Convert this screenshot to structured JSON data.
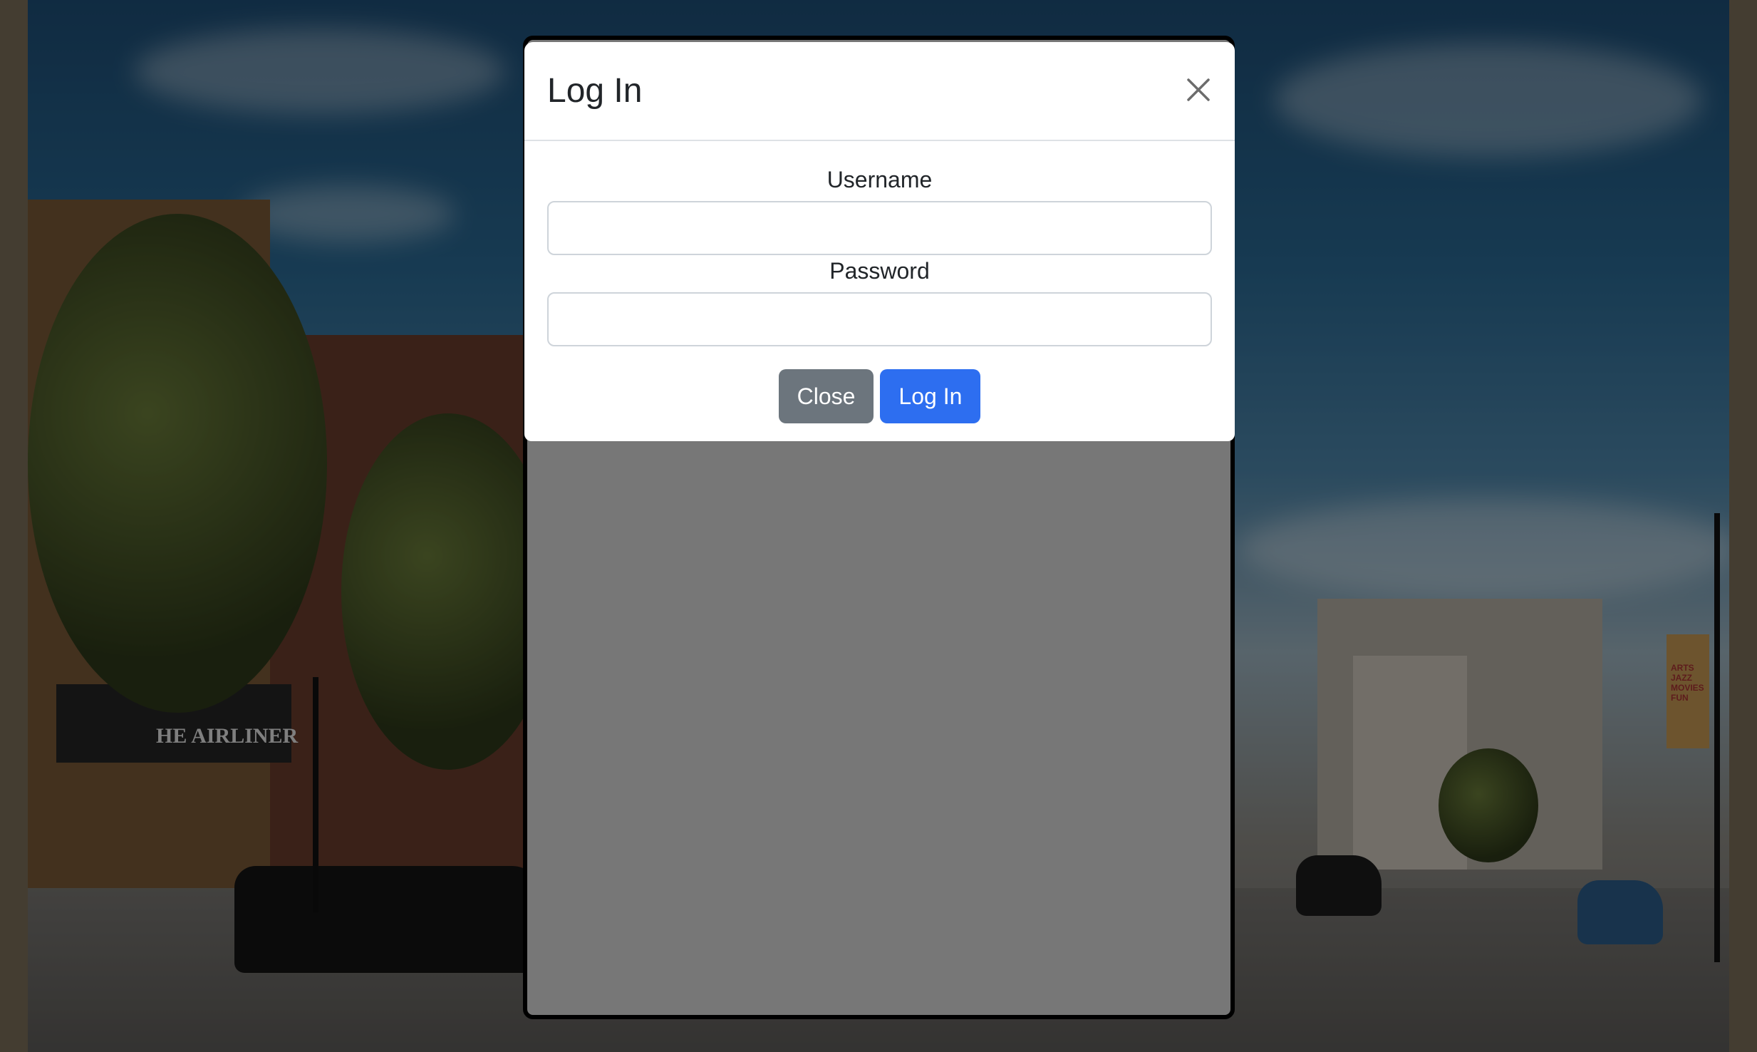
{
  "modal": {
    "title": "Log In",
    "username_label": "Username",
    "password_label": "Password",
    "username_value": "",
    "password_value": "",
    "close_button": "Close",
    "login_button": "Log In"
  },
  "background": {
    "storefront_sign": "HE AIRLINER",
    "banner_text": "ARTS JAZZ MOVIES FUN"
  },
  "colors": {
    "primary": "#2d6ef0",
    "secondary": "#6c757d",
    "overlay": "#777777"
  }
}
